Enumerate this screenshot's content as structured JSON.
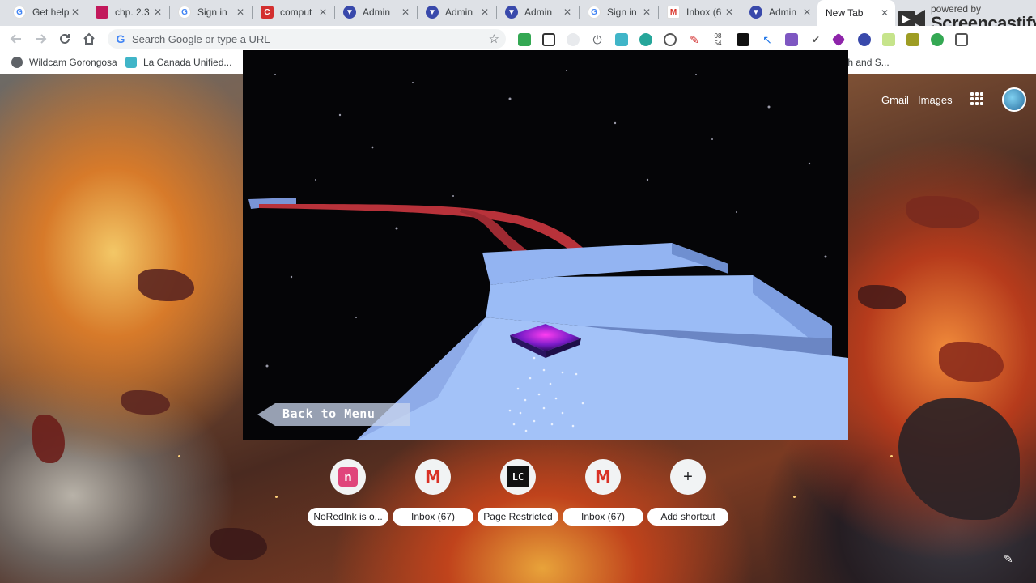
{
  "tabs": [
    {
      "title": "Get help",
      "favicon": "google-icon",
      "active": false
    },
    {
      "title": "chp. 2.3",
      "favicon": "classroom-icon",
      "active": false
    },
    {
      "title": "Sign in",
      "favicon": "google-icon",
      "active": false
    },
    {
      "title": "comput",
      "favicon": "c-icon",
      "active": false
    },
    {
      "title": "Admin",
      "favicon": "admin-icon",
      "active": false
    },
    {
      "title": "Admin",
      "favicon": "admin-icon",
      "active": false
    },
    {
      "title": "Admin",
      "favicon": "admin-icon",
      "active": false
    },
    {
      "title": "Sign in",
      "favicon": "google-icon",
      "active": false
    },
    {
      "title": "Inbox (6",
      "favicon": "gmail-icon",
      "active": false
    },
    {
      "title": "Admin",
      "favicon": "admin-icon",
      "active": false
    },
    {
      "title": "New Tab",
      "favicon": "",
      "active": true
    }
  ],
  "watermark": {
    "powered_by": "powered by",
    "name": "Screencastify"
  },
  "omnibox": {
    "placeholder": "Search Google or type a URL"
  },
  "clock_ext": {
    "line1": "08",
    "line2": "54"
  },
  "bookmarks": [
    {
      "label": "Wildcam Gorongosa",
      "color": "#5f6368"
    },
    {
      "label": "La Canada Unified...",
      "color": "#40b5c8"
    },
    {
      "label": "th and S...",
      "color": "#888"
    }
  ],
  "page_header": {
    "gmail": "Gmail",
    "images": "Images"
  },
  "game": {
    "back_to_menu": "Back to Menu"
  },
  "shortcuts": [
    {
      "label": "NoRedInk is o...",
      "icon": "noredink-icon"
    },
    {
      "label": "Inbox (67)",
      "icon": "gmail-icon"
    },
    {
      "label": "Page Restricted",
      "icon": "lc-icon"
    },
    {
      "label": "Inbox (67)",
      "icon": "gmail-icon"
    },
    {
      "label": "Add shortcut",
      "icon": "plus-icon"
    }
  ],
  "colors": {
    "tabstrip": "#dee1e6",
    "track_blue": "#93b4f2",
    "rail_red": "#b8323a",
    "player_purple": "#6a1fb0"
  }
}
